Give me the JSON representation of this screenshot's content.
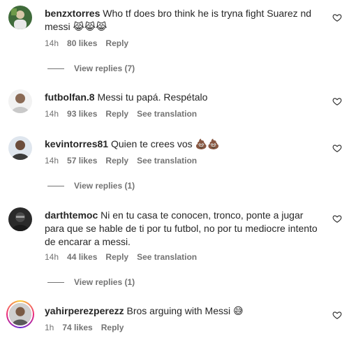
{
  "comments": [
    {
      "username": "benzxtorres",
      "text": "Who tf does bro think he is tryna fight Suarez nd messi 😹😹😹",
      "time": "14h",
      "likes": "80 likes",
      "reply": "Reply",
      "translate": "",
      "view_replies": "View replies (7)"
    },
    {
      "username": "futbolfan.8",
      "text": "Messi tu papá. Respétalo",
      "time": "14h",
      "likes": "93 likes",
      "reply": "Reply",
      "translate": "See translation",
      "view_replies": ""
    },
    {
      "username": "kevintorres81",
      "text": "Quien te crees vos 💩💩",
      "time": "14h",
      "likes": "57 likes",
      "reply": "Reply",
      "translate": "See translation",
      "view_replies": "View replies (1)"
    },
    {
      "username": "darthtemoc",
      "text": "Ni en tu casa te conocen, tronco, ponte a jugar para que se hable de ti por tu futbol, no por tu mediocre intento de encarar a messi.",
      "time": "14h",
      "likes": "44 likes",
      "reply": "Reply",
      "translate": "See translation",
      "view_replies": "View replies (1)"
    },
    {
      "username": "yahirperezperezz",
      "text": "Bros arguing with Messi 😅",
      "time": "1h",
      "likes": "74 likes",
      "reply": "Reply",
      "translate": "",
      "view_replies": ""
    }
  ],
  "colors": {
    "text": "#262626",
    "secondary": "#737373",
    "story_ring_start": "#f9ce34",
    "story_ring_end": "#6228d7"
  },
  "icons": {
    "like": "heart-outline-icon"
  }
}
